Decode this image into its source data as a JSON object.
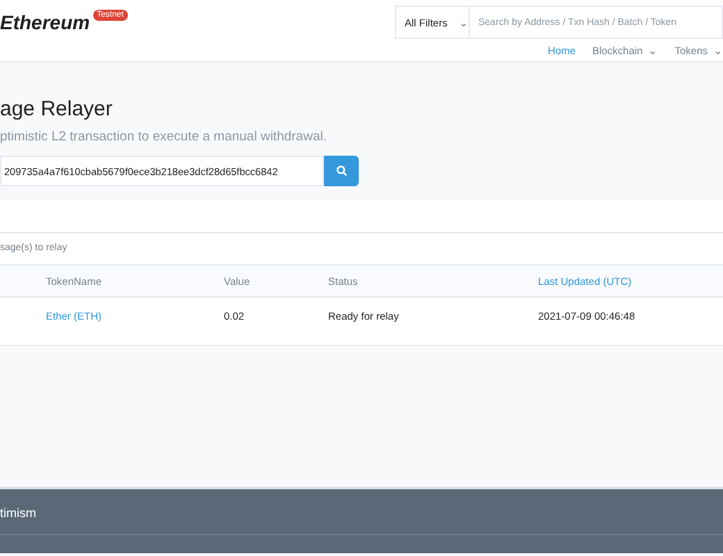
{
  "header": {
    "logo": "Ethereum",
    "badge": "Testnet",
    "filter": {
      "value": "All Filters",
      "caret": "⌄"
    },
    "search": {
      "placeholder": "Search by Address / Txn Hash / Batch / Token"
    },
    "nav": [
      {
        "label": "Home",
        "selected": true,
        "dropdown": false
      },
      {
        "label": "Blockchain",
        "selected": false,
        "dropdown": true
      },
      {
        "label": "Tokens",
        "selected": false,
        "dropdown": true
      }
    ]
  },
  "relayer": {
    "title": "age Relayer",
    "subtitle": "ptimistic L2 transaction to execute a manual withdrawal.",
    "input": {
      "value": "209735a4a7f610cbab5679f0ece3b218ee3dcf28d65fbcc6842"
    }
  },
  "results": {
    "summary": "sage(s) to relay",
    "columns": [
      {
        "label": "TokenName",
        "sortable": false
      },
      {
        "label": "Value",
        "sortable": false
      },
      {
        "label": "Status",
        "sortable": false
      },
      {
        "label": "Last Updated (UTC)",
        "sortable": true
      }
    ],
    "rows": [
      {
        "token": "Ether (ETH)",
        "value": "0.02",
        "status": "Ready for relay",
        "updated": "2021-07-09 00:46:48"
      }
    ]
  },
  "footer": {
    "brand": "timism"
  }
}
